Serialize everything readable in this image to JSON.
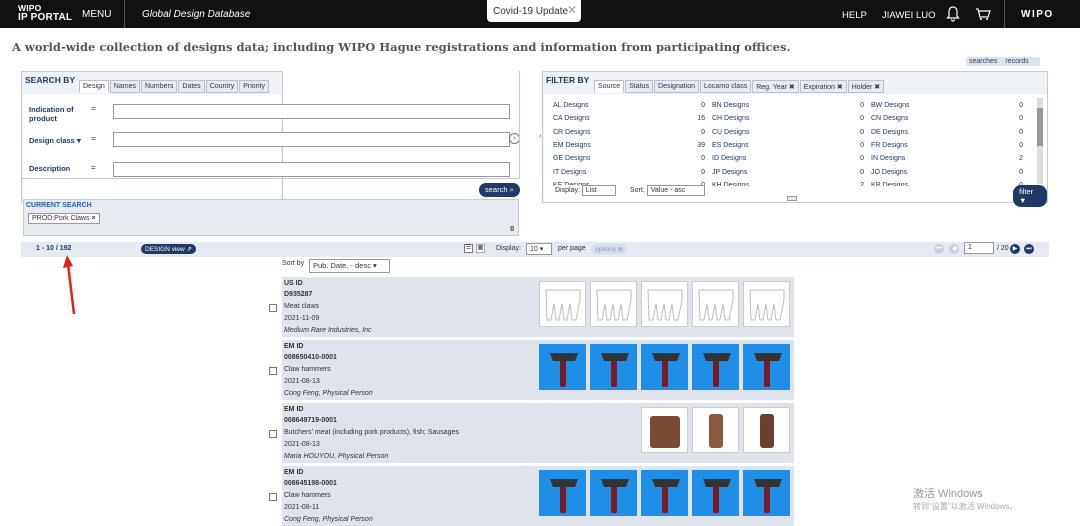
{
  "header": {
    "logo_top": "WIPO",
    "logo_bottom": "IP PORTAL",
    "menu": "MENU",
    "app_title": "Global Design Database",
    "covid": "Covid-19 Update",
    "help": "HELP",
    "user": "JIAWEI LUO",
    "wipo": "WIPO"
  },
  "tagline": "A world-wide collection of designs data; including WIPO Hague registrations and information from participating offices.",
  "top_links": {
    "searches": "searches",
    "records": "records"
  },
  "search_by": {
    "title": "SEARCH BY",
    "tabs": [
      "Design",
      "Names",
      "Numbers",
      "Dates",
      "Country",
      "Priority"
    ],
    "fields": {
      "indication": "Indication of product",
      "design_class": "Design class",
      "description": "Description"
    },
    "eq": "=",
    "search_button": "search",
    "current_label": "CURRENT SEARCH",
    "current_chip": "PROD:Pork Claws",
    "current_count": "0"
  },
  "filter_by": {
    "title": "FILTER BY",
    "tabs": [
      "Source",
      "Status",
      "Designation",
      "Locarno class",
      "Reg. Year",
      "Expiration",
      "Holder"
    ],
    "items": [
      [
        "AL Designs",
        "0",
        "BN Designs",
        "0",
        "BW Designs",
        "0"
      ],
      [
        "CA Designs",
        "16",
        "CH Designs",
        "0",
        "CN Designs",
        "0"
      ],
      [
        "CR Designs",
        "0",
        "CU Designs",
        "0",
        "DE Designs",
        "0"
      ],
      [
        "EM Designs",
        "39",
        "ES Designs",
        "0",
        "FR Designs",
        "0"
      ],
      [
        "GE Designs",
        "0",
        "ID Designs",
        "0",
        "IN Designs",
        "2"
      ],
      [
        "IT Designs",
        "0",
        "JP Designs",
        "0",
        "JO Designs",
        "0"
      ],
      [
        "KE Designs",
        "0",
        "KH Designs",
        "2",
        "KR Designs",
        "0"
      ]
    ],
    "display_label": "Display:",
    "display_value": "List",
    "sort_label": "Sort:",
    "sort_value": "Value - asc",
    "filter_button": "filter"
  },
  "results_bar": {
    "range": "1 - 10 / 192",
    "design_view": "DESIGN view",
    "display_label": "Display:",
    "per_page_value": "10",
    "per_page_label": "per page",
    "options": "options",
    "page_value": "1",
    "page_total": "/ 20"
  },
  "sort": {
    "label": "Sort by",
    "value": "Pub. Date. - desc"
  },
  "results": [
    {
      "office": "US ID",
      "number": "D935287",
      "title": "Meat claws",
      "date": "2021-11-09",
      "owner": "Medium Rare Industries, Inc"
    },
    {
      "office": "EM ID",
      "number": "008650410-0001",
      "title": "Claw hammers",
      "date": "2021-08-13",
      "owner": "Cong Feng, Physical Person"
    },
    {
      "office": "EM ID",
      "number": "008649719-0001",
      "title": "Butchers' meat (including pork products), fish; Sausages",
      "date": "2021-08-13",
      "owner": "Maria HOUYOU, Physical Person"
    },
    {
      "office": "EM ID",
      "number": "008645198-0001",
      "title": "Claw hammers",
      "date": "2021-08-11",
      "owner": "Cong Feng, Physical Person"
    }
  ],
  "watermark": {
    "line1": "激活 Windows",
    "line2": "转到\"设置\"以激活 Windows。"
  }
}
